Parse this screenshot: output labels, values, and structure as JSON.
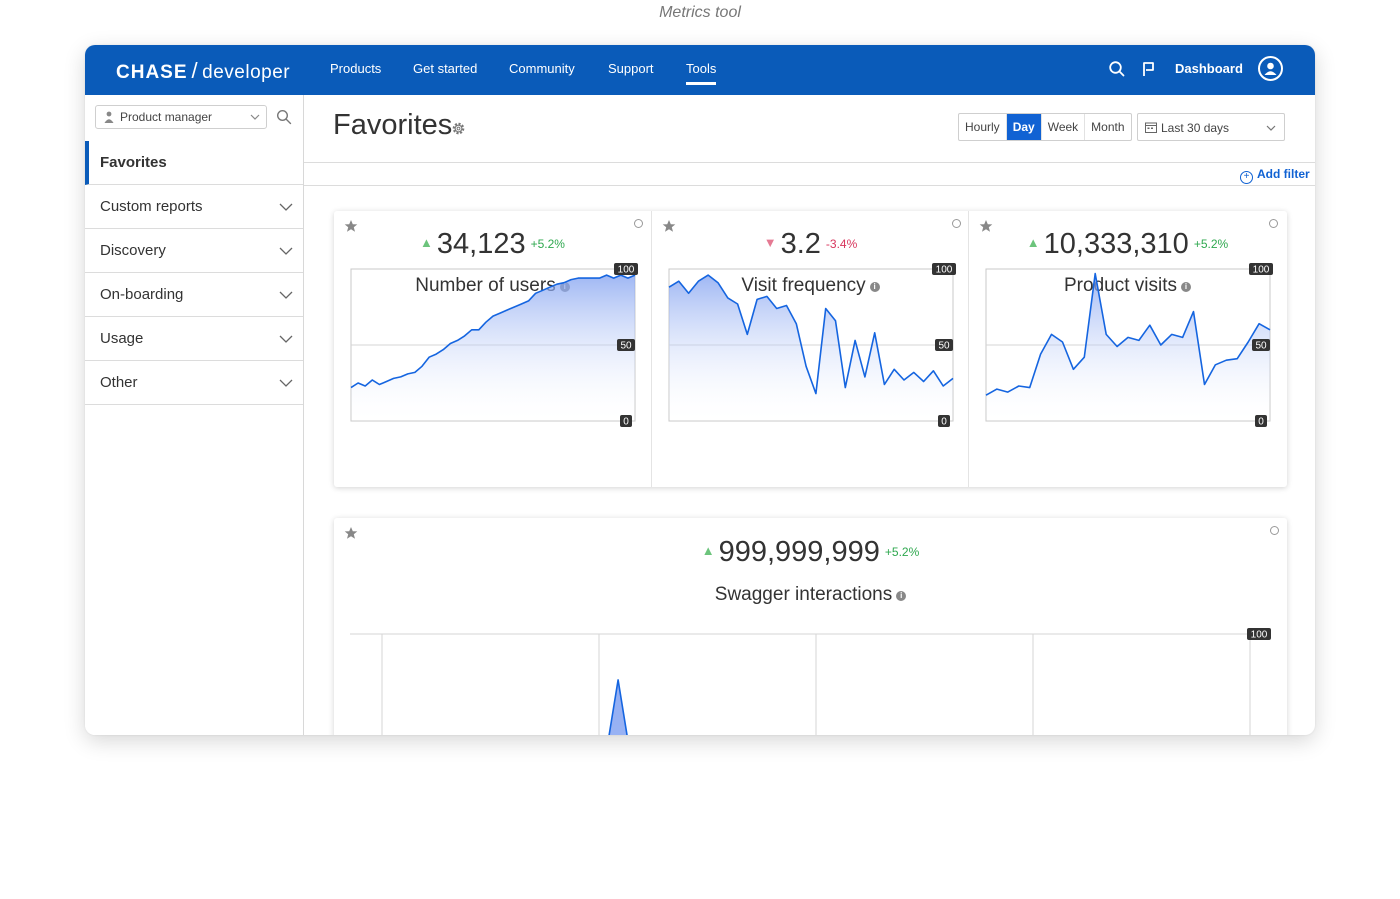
{
  "caption": "Metrics tool",
  "topnav": {
    "brand": "CHASE",
    "brand_sub": "developer",
    "links": [
      "Products",
      "Get started",
      "Community",
      "Support",
      "Tools"
    ],
    "active_link": "Tools",
    "dashboard_label": "Dashboard",
    "bg_color": "#0a5bb9"
  },
  "sidebar": {
    "role_select": "Product manager",
    "items": [
      {
        "label": "Favorites",
        "active": true
      },
      {
        "label": "Custom reports"
      },
      {
        "label": "Discovery"
      },
      {
        "label": "On-boarding"
      },
      {
        "label": "Usage"
      },
      {
        "label": "Other"
      }
    ]
  },
  "main": {
    "title": "Favorites",
    "granularity": [
      "Hourly",
      "Day",
      "Week",
      "Month"
    ],
    "granularity_selected": "Day",
    "date_range": "Last 30 days",
    "add_filter": "Add filter"
  },
  "cards": [
    {
      "value": "34,123",
      "change": "+5.2%",
      "direction": "up",
      "label": "Number of users"
    },
    {
      "value": "3.2",
      "change": "-3.4%",
      "direction": "down",
      "label": "Visit frequency"
    },
    {
      "value": "10,333,310",
      "change": "+5.2%",
      "direction": "up",
      "label": "Product visits"
    }
  ],
  "big_card": {
    "value": "999,999,999",
    "change": "+5.2%",
    "direction": "up",
    "label": "Swagger interactions"
  },
  "chart_data": [
    {
      "type": "area",
      "title": "Number of users",
      "ylim": [
        0,
        100
      ],
      "yticks": [
        "0",
        "50",
        "100"
      ],
      "values": [
        22,
        25,
        23,
        27,
        24,
        26,
        28,
        29,
        31,
        32,
        36,
        42,
        44,
        47,
        51,
        53,
        56,
        60,
        60,
        65,
        69,
        71,
        73,
        75,
        77,
        79,
        84,
        86,
        88,
        90,
        91,
        93,
        94,
        94,
        94,
        94,
        96,
        94,
        96,
        94,
        96
      ]
    },
    {
      "type": "area",
      "title": "Visit frequency",
      "ylim": [
        0,
        100
      ],
      "yticks": [
        "0",
        "50",
        "100"
      ],
      "values": [
        88,
        92,
        84,
        92,
        96,
        91,
        81,
        77,
        57,
        80,
        82,
        74,
        76,
        64,
        36,
        18,
        74,
        66,
        22,
        53,
        29,
        58,
        24,
        34,
        27,
        32,
        26,
        33,
        23,
        28
      ]
    },
    {
      "type": "area",
      "title": "Product visits",
      "ylim": [
        0,
        100
      ],
      "yticks": [
        "0",
        "50",
        "100"
      ],
      "values": [
        17,
        21,
        19,
        23,
        22,
        44,
        57,
        52,
        34,
        42,
        97,
        57,
        49,
        55,
        53,
        63,
        50,
        57,
        55,
        72,
        24,
        37,
        40,
        41,
        52,
        64,
        60
      ]
    },
    {
      "type": "area",
      "title": "Swagger interactions",
      "ylim": [
        0,
        100
      ],
      "yticks": [
        "100"
      ],
      "values": [
        0,
        0,
        0,
        0,
        0,
        0,
        0,
        0,
        0,
        0,
        0,
        0,
        0,
        0,
        72,
        0,
        0,
        0,
        0,
        0,
        0,
        0,
        0,
        0,
        0,
        0,
        0,
        0,
        0,
        0,
        0,
        0,
        0,
        0,
        0,
        0,
        0,
        0,
        0,
        0,
        0,
        0,
        0,
        0,
        0,
        0,
        0,
        0
      ]
    }
  ]
}
